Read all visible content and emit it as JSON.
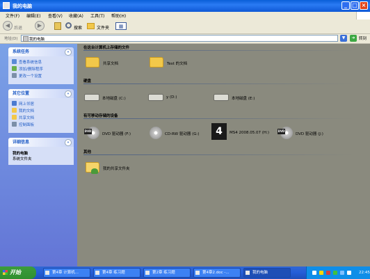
{
  "window": {
    "title": "我的电脑",
    "controls": {
      "minimize": "_",
      "maximize": "□",
      "close": "×"
    }
  },
  "menu": [
    "文件(F)",
    "编辑(E)",
    "查看(V)",
    "收藏(A)",
    "工具(T)",
    "帮助(H)"
  ],
  "toolbar": {
    "back": "后退",
    "search": "搜索",
    "folders": "文件夹",
    "back_icon": "◀",
    "forward_icon": "▶",
    "views_icon": "▦"
  },
  "address": {
    "label": "地址(D)",
    "value": "我的电脑",
    "dropdown_icon": "▼",
    "go_icon": "➜",
    "go_label": "转到"
  },
  "left_panels": {
    "system_tasks": {
      "title": "系统任务",
      "chevron": "«",
      "items": [
        "查看系统信息",
        "添加/删除程序",
        "更改一个设置"
      ]
    },
    "other_places": {
      "title": "其它位置",
      "chevron": "«",
      "items": [
        "网上邻居",
        "我的文档",
        "共享文档",
        "控制面板"
      ]
    },
    "details": {
      "title": "详细信息",
      "chevron": "«",
      "name": "我的电脑",
      "type": "系统文件夹"
    }
  },
  "sections": {
    "files_stored": {
      "title": "在这台计算机上存储的文件",
      "items": [
        "共享文档",
        "Test 的文档"
      ]
    },
    "hard_drives": {
      "title": "硬盘",
      "items": [
        "本地磁盘 (C:)",
        "y (D:)",
        "本地磁盘 (E:)"
      ]
    },
    "removable": {
      "title": "有可移动存储的设备",
      "items": [
        "DVD 驱动器 (F:)",
        "CD-RW 驱动器 (G:)",
        "MS4 2008.05.07 (H:)",
        "DVD 驱动器 (J:)"
      ],
      "dvd_tag": "DVD",
      "ms4_tag": "4"
    },
    "other": {
      "title": "其他",
      "items": [
        "我的共享文件夹"
      ]
    }
  },
  "taskbar": {
    "start": "开始",
    "buttons": [
      "第4章 计算机...",
      "第4章 练习题",
      "第2章 练习题",
      "第4章2.doc -...",
      "我的电脑"
    ],
    "clock": "22:45"
  },
  "colors": {
    "title_bar": "#0a5fd8",
    "left_pane": "#6f8fe0",
    "content_bg": "#8a8a7e",
    "taskbar": "#245dd7",
    "start_button": "#3c9c3c",
    "link": "#215dc6"
  }
}
